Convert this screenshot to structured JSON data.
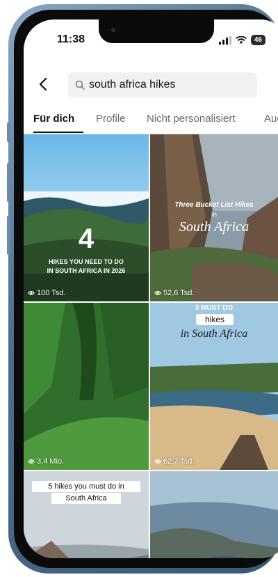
{
  "status": {
    "time": "11:38",
    "battery": "46"
  },
  "search": {
    "query": "south africa hikes"
  },
  "tabs": [
    "Für dich",
    "Profile",
    "Nicht personalisiert",
    "Aud"
  ],
  "results": [
    {
      "big": "4",
      "caption_line1": "HIKES YOU NEED TO DO",
      "caption_line2": "IN SOUTH AFRICA IN 2026",
      "views": "100 Tsd."
    },
    {
      "caption_line1": "Three Bucket List Hikes",
      "caption_line2": "in",
      "caption_line3": "South Africa",
      "views": "52,6 Tsd."
    },
    {
      "views": "3,4 Mio."
    },
    {
      "caption_top": "3 MUST DO",
      "caption_line1": "hikes",
      "caption_line2": "in South Africa",
      "views": "62,7 Tsd."
    },
    {
      "caption_line1": "5 hikes you must do in",
      "caption_line2": "South Africa"
    },
    {}
  ],
  "colors": {
    "frame": "#4f6e8d",
    "text": "#111111",
    "muted": "#6b6b6b"
  }
}
